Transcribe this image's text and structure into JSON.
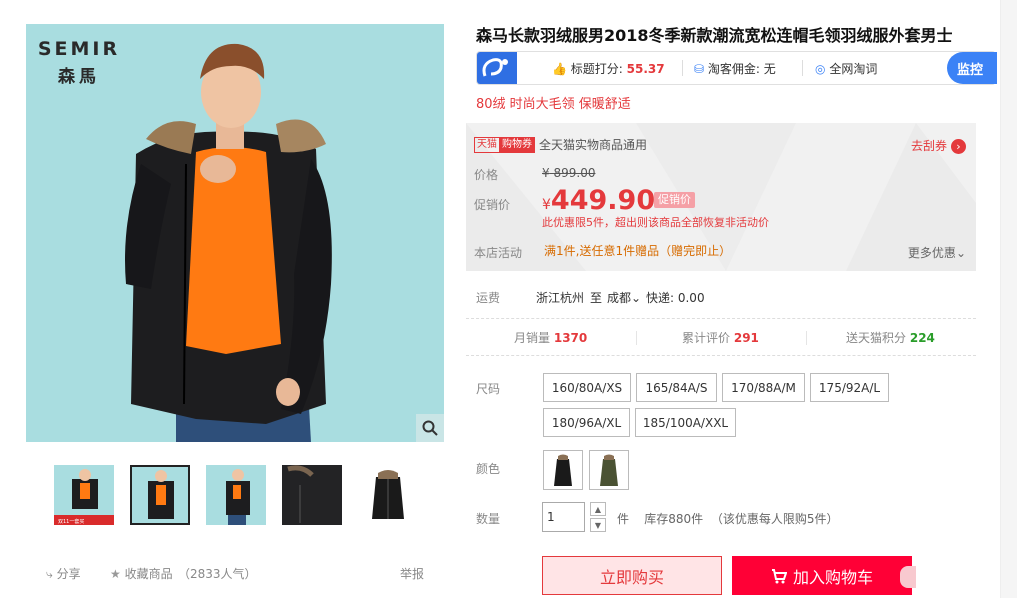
{
  "gallery": {
    "brand_en": "SEMIR",
    "brand_cn": "森馬",
    "zoom_icon": "magnifier-icon",
    "thumbnail_count": 5,
    "selected_thumbnail": 2,
    "thumb1_caption": "双11一套买"
  },
  "share": {
    "share_label": "分享",
    "favorite_label": "收藏商品",
    "popularity": "（2833人气）",
    "report_label": "举报"
  },
  "product": {
    "title": "森马长款羽绒服男2018冬季新款潮流宽松连帽毛领羽绒服外套男士",
    "subtitle": "80绒 时尚大毛领 保暖舒适"
  },
  "toolbar": {
    "score_label": "标题打分:",
    "score_value": "55.37",
    "commission_label": "淘客佣金:",
    "commission_value": "无",
    "search_label": "全网淘词",
    "monitor_label": "监控"
  },
  "pricing": {
    "tmall_tag": "天猫",
    "coupon_tag": "购物券",
    "coupon_text": "全天猫实物商品通用",
    "get_coupon": "去刮券",
    "price_label": "价格",
    "currency": "¥",
    "original_price": "899.00",
    "promo_label": "促销价",
    "promo_price": "449.90",
    "promo_badge": "促销价",
    "limit_note": "此优惠限5件，超出则该商品全部恢复非活动价",
    "activity_label": "本店活动",
    "activity_text": "满1件,送任意1件赠品（赠完即止）",
    "more_promo": "更多优惠"
  },
  "shipping": {
    "label": "运费",
    "from": "浙江杭州",
    "to_word": "至",
    "to": "成都",
    "express": "快递: 0.00"
  },
  "stats": {
    "monthly_sales_label": "月销量",
    "monthly_sales": "1370",
    "reviews_label": "累计评价",
    "reviews": "291",
    "points_label": "送天猫积分",
    "points": "224"
  },
  "sku": {
    "size_label": "尺码",
    "sizes": [
      "160/80A/XS",
      "165/84A/S",
      "170/88A/M",
      "175/92A/L",
      "180/96A/XL",
      "185/100A/XXL"
    ],
    "color_label": "颜色",
    "colors": [
      "黑色",
      "军绿色"
    ],
    "quantity_label": "数量",
    "quantity_value": "1",
    "unit": "件",
    "stock": "库存880件",
    "stock_note": "（该优惠每人限购5件）"
  },
  "actions": {
    "buy_now": "立即购买",
    "add_to_cart": "加入购物车"
  }
}
